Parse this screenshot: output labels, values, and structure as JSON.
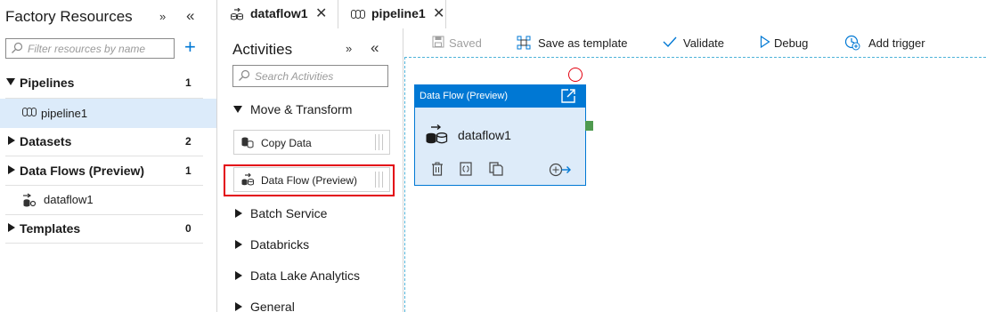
{
  "left_panel": {
    "title": "Factory Resources",
    "search_placeholder": "Filter resources by name",
    "sections": [
      {
        "label": "Pipelines",
        "count": "1",
        "children": [
          {
            "label": "pipeline1"
          }
        ]
      },
      {
        "label": "Datasets",
        "count": "2"
      },
      {
        "label": "Data Flows (Preview)",
        "count": "1",
        "children": [
          {
            "label": "dataflow1"
          }
        ]
      },
      {
        "label": "Templates",
        "count": "0"
      }
    ]
  },
  "tabs": [
    {
      "label": "dataflow1",
      "icon": "dataflow-icon",
      "active": false
    },
    {
      "label": "pipeline1",
      "icon": "pipeline-icon",
      "active": true
    }
  ],
  "activities": {
    "title": "Activities",
    "search_placeholder": "Search Activities",
    "categories": [
      {
        "label": "Move & Transform",
        "expanded": true,
        "items": [
          {
            "label": "Copy Data",
            "icon": "copy-data-icon"
          },
          {
            "label": "Data Flow (Preview)",
            "icon": "dataflow-icon",
            "highlighted": true
          }
        ]
      },
      {
        "label": "Batch Service",
        "expanded": false
      },
      {
        "label": "Databricks",
        "expanded": false
      },
      {
        "label": "Data Lake Analytics",
        "expanded": false
      },
      {
        "label": "General",
        "expanded": false
      }
    ]
  },
  "toolbar": {
    "saved": {
      "label": "Saved",
      "icon": "save-icon",
      "disabled": true
    },
    "save_template": {
      "label": "Save as template",
      "icon": "template-icon"
    },
    "validate": {
      "label": "Validate",
      "icon": "checkmark-icon"
    },
    "debug": {
      "label": "Debug",
      "icon": "play-icon"
    },
    "add_trigger": {
      "label": "Add trigger",
      "icon": "trigger-icon"
    }
  },
  "canvas": {
    "node": {
      "header": "Data Flow (Preview)",
      "name": "dataflow1",
      "actions": [
        "delete-icon",
        "code-icon",
        "copy-icon",
        "add-output-icon"
      ]
    }
  },
  "colors": {
    "accent": "#0078d4",
    "selected_row": "#dcebfa",
    "node_body": "#ddebf9",
    "highlight": "#e3000f",
    "success_port": "#4f9a4f"
  }
}
